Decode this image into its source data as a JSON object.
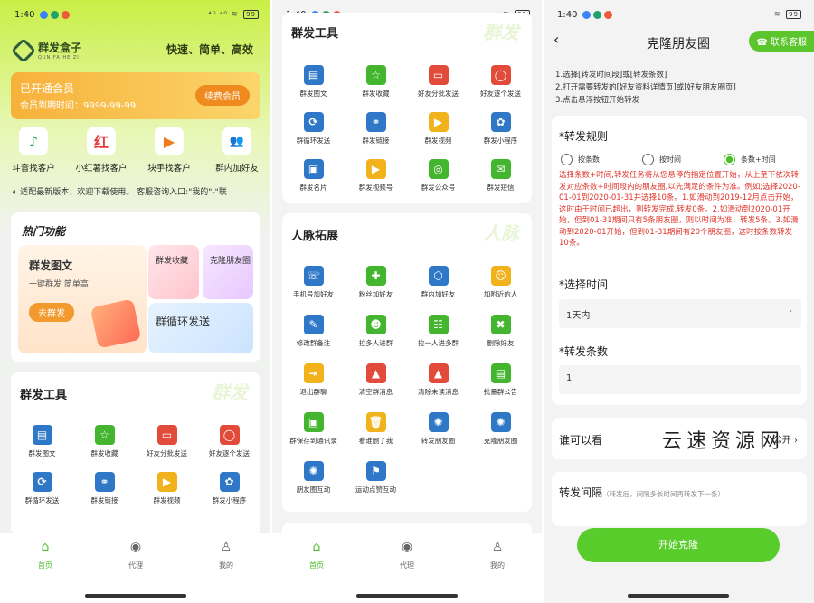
{
  "status": {
    "time": "1:40",
    "net": "46.0 K/S",
    "signal": "⁴ᴳ ⁴ᴳ",
    "battery": "99"
  },
  "p1": {
    "logo_title": "群发盒子",
    "logo_sub": "QUN FA HE ZI",
    "slogan": "快速、简单、高效",
    "vip": {
      "title": "已开通会员",
      "expire": "会员到期时间：9999-99-99",
      "button": "续费会员"
    },
    "quick": [
      {
        "label": "斗音找客户",
        "icon": "♪"
      },
      {
        "label": "小红薯找客户",
        "icon": "红"
      },
      {
        "label": "块手找客户",
        "icon": "▶"
      },
      {
        "label": "群内加好友",
        "icon": "👥"
      }
    ],
    "notice": "适配最新版本，欢迎下载使用。 客服咨询入口:\"我的\"-\"联",
    "hot": {
      "title": "热门功能",
      "big_title": "群发图文",
      "big_sub": "一键群发 简单高",
      "big_btn": "去群发",
      "sm1": "群发收藏",
      "sm2": "克隆朋友圈",
      "sm3": "群循环发送"
    },
    "tools_title": "群发工具",
    "tools_wm": "群发",
    "tools": [
      {
        "label": "群发图文",
        "color": "#2f78c8",
        "g": "▤"
      },
      {
        "label": "群发收藏",
        "color": "#43b52e",
        "g": "☆"
      },
      {
        "label": "好友分批发送",
        "color": "#e24b3a",
        "g": "▭"
      },
      {
        "label": "好友逐个发送",
        "color": "#e24b3a",
        "g": "◯"
      },
      {
        "label": "群循环发送",
        "color": "#2f78c8",
        "g": "⟳"
      },
      {
        "label": "群发链接",
        "color": "#2f78c8",
        "g": "⚭"
      },
      {
        "label": "群发视频",
        "color": "#f2b21c",
        "g": "▶"
      },
      {
        "label": "群发小程序",
        "color": "#2f78c8",
        "g": "✿"
      }
    ]
  },
  "tabs": [
    {
      "label": "首页",
      "icon": "⌂"
    },
    {
      "label": "代理",
      "icon": "◉"
    },
    {
      "label": "我的",
      "icon": "♙"
    }
  ],
  "p2": {
    "tools_title": "群发工具",
    "tools_wm": "群发",
    "tools": [
      {
        "label": "群发图文",
        "color": "#2f78c8",
        "g": "▤"
      },
      {
        "label": "群发收藏",
        "color": "#43b52e",
        "g": "☆"
      },
      {
        "label": "好友分批发送",
        "color": "#e24b3a",
        "g": "▭"
      },
      {
        "label": "好友逐个发送",
        "color": "#e24b3a",
        "g": "◯"
      },
      {
        "label": "群循环发送",
        "color": "#2f78c8",
        "g": "⟳"
      },
      {
        "label": "群发链接",
        "color": "#2f78c8",
        "g": "⚭"
      },
      {
        "label": "群发视频",
        "color": "#f2b21c",
        "g": "▶"
      },
      {
        "label": "群发小程序",
        "color": "#2f78c8",
        "g": "✿"
      },
      {
        "label": "群发名片",
        "color": "#2f78c8",
        "g": "▣"
      },
      {
        "label": "群发视频号",
        "color": "#f2b21c",
        "g": "▶"
      },
      {
        "label": "群发公众号",
        "color": "#43b52e",
        "g": "◎"
      },
      {
        "label": "群发短信",
        "color": "#43b52e",
        "g": "✉"
      }
    ],
    "contacts_title": "人脉拓展",
    "contacts_wm": "人脉",
    "contacts": [
      {
        "label": "手机号加好友",
        "color": "#2f78c8",
        "g": "☏"
      },
      {
        "label": "粉丝加好友",
        "color": "#43b52e",
        "g": "✚"
      },
      {
        "label": "群内加好友",
        "color": "#2f78c8",
        "g": "⬡"
      },
      {
        "label": "加附近的人",
        "color": "#f2b21c",
        "g": "☺"
      },
      {
        "label": "修改群备注",
        "color": "#2f78c8",
        "g": "✎"
      },
      {
        "label": "拉多人进群",
        "color": "#43b52e",
        "g": "☻"
      },
      {
        "label": "拉一人进多群",
        "color": "#43b52e",
        "g": "☷"
      },
      {
        "label": "删除好友",
        "color": "#43b52e",
        "g": "✖"
      },
      {
        "label": "退出群聊",
        "color": "#f2b21c",
        "g": "⇥"
      },
      {
        "label": "清空群消息",
        "color": "#e24b3a",
        "g": "▲"
      },
      {
        "label": "清除未读消息",
        "color": "#e24b3a",
        "g": "▲"
      },
      {
        "label": "批量群公告",
        "color": "#43b52e",
        "g": "▤"
      },
      {
        "label": "群保存到通讯录",
        "color": "#43b52e",
        "g": "▣"
      },
      {
        "label": "看谁删了我",
        "color": "#f2b21c",
        "g": "🗑"
      },
      {
        "label": "转发朋友圈",
        "color": "#2f78c8",
        "g": "✺"
      },
      {
        "label": "克隆朋友圈",
        "color": "#2f78c8",
        "g": "✺"
      },
      {
        "label": "朋友圈互动",
        "color": "#2f78c8",
        "g": "✺"
      },
      {
        "label": "运动点赞互动",
        "color": "#2f78c8",
        "g": "⚑"
      }
    ]
  },
  "p3": {
    "title": "克隆朋友圈",
    "support": "联系客服",
    "steps": [
      "1.选择[转发时间段]或[转发条数]",
      "2.打开需要转发的[好友资料详情页]或[好友朋友圈页]",
      "3.点击悬浮按钮开始转发"
    ],
    "rule_label": "*转发规则",
    "radios": [
      "按条数",
      "按时间",
      "条数+时间"
    ],
    "rule_text": "选择条数+时间,转发任务将从您悬停的指定位置开始，从上至下依次转发对应条数+时间段内的朋友圈,以先满足的条件为准。例如;选择2020-01-01到2020-01-31并选择10条。1.如滑动到2019-12月点击开始，这时由于时间已超出，则转发完成,转发0条。2.如滑动到2020-01开始，但到01-31期间只有5条朋友圈，则以时间为准，转发5条。3.如滑动到2020-01开始，但到01-31期间有20个朋友圈，这时按条数转发10条。",
    "time_label": "*选择时间",
    "time_value": "1天内",
    "count_label": "*转发条数",
    "count_value": "1",
    "who_label": "谁可以看",
    "who_value": "公开",
    "interval_label": "转发间隔",
    "interval_hint": "（转发后，间隔多长时间再转发下一条）",
    "start": "开始克隆"
  },
  "watermark": "云速资源网"
}
